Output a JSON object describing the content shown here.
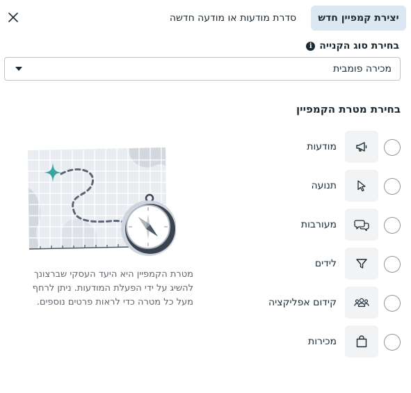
{
  "tabs": {
    "active_label": "יצירת קמפיין חדש",
    "other_label": "סדרת מודעות או מודעה חדשה"
  },
  "buying_type": {
    "label": "בחירת סוג הקנייה",
    "info_icon": "i",
    "selected_value": "מכירה פומבית"
  },
  "objectives": {
    "title": "בחירת מטרת הקמפיין",
    "items": [
      {
        "label": "מודעות",
        "icon": "megaphone-icon"
      },
      {
        "label": "תנועה",
        "icon": "cursor-icon"
      },
      {
        "label": "מעורבות",
        "icon": "chat-bubbles-icon"
      },
      {
        "label": "לידים",
        "icon": "funnel-icon"
      },
      {
        "label": "קידום אפליקציה",
        "icon": "people-icon"
      },
      {
        "label": "מכירות",
        "icon": "shopping-bag-icon"
      }
    ]
  },
  "description": "מטרת הקמפיין היא היעד העסקי שברצונך להשיג על ידי הפעלת המודעות. ניתן לרחף מעל כל מטרה כדי לראות פרטים נוספים.",
  "colors": {
    "tab_active_bg": "#dbe7f2",
    "text_dark": "#1c2b33",
    "text_muted": "#606770",
    "icon_box_bg": "#f2f3f5",
    "illustration_teal": "#3aa5a0"
  }
}
